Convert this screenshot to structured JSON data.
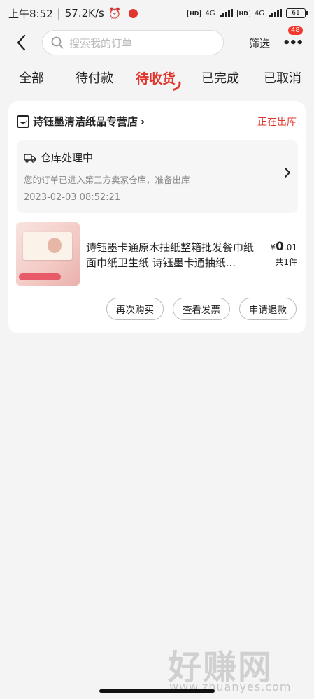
{
  "status_bar": {
    "time": "上午8:52",
    "speed": "57.2K/s",
    "net1": "4G",
    "net2": "4G",
    "hd": "HD",
    "battery": "61"
  },
  "header": {
    "search_placeholder": "搜索我的订单",
    "filter_label": "筛选",
    "badge_count": "48"
  },
  "tabs": [
    {
      "label": "全部",
      "active": false
    },
    {
      "label": "待付款",
      "active": false
    },
    {
      "label": "待收货",
      "active": true
    },
    {
      "label": "已完成",
      "active": false
    },
    {
      "label": "已取消",
      "active": false
    }
  ],
  "order": {
    "shop_name": "诗钰墨清洁纸品专营店",
    "status": "正在出库",
    "logistics": {
      "title": "仓库处理中",
      "desc": "您的订单已进入第三方卖家仓库，准备出库",
      "time": "2023-02-03 08:52:21"
    },
    "product": {
      "title": "诗钰墨卡通原木抽纸整箱批发餐巾纸面巾纸卫生纸 诗钰墨卡通抽纸...",
      "price_symbol": "¥",
      "price_int": "0",
      "price_dec": ".01",
      "quantity": "共1件"
    },
    "buttons": {
      "rebuy": "再次购买",
      "invoice": "查看发票",
      "refund": "申请退款"
    }
  },
  "watermark": {
    "big": "好赚网",
    "small": "www.zhuanyes.com"
  },
  "colors": {
    "accent": "#e0362e",
    "background": "#f4f4f5"
  }
}
